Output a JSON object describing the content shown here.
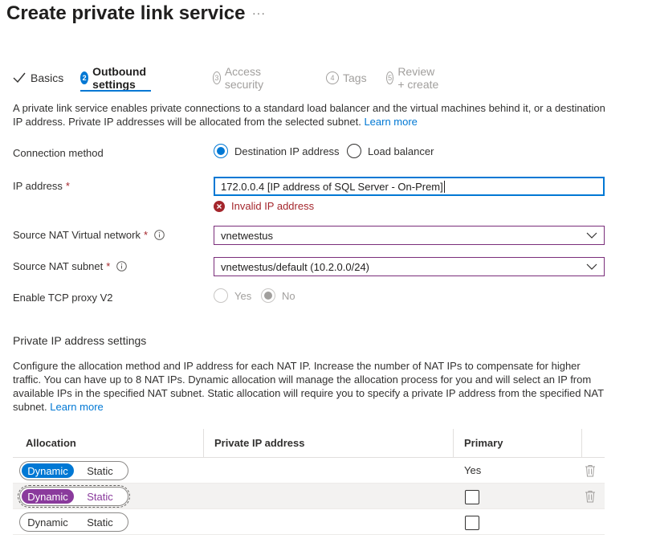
{
  "header": {
    "title": "Create private link service",
    "more": "···"
  },
  "tabs": [
    {
      "label": "Basics",
      "state": "done"
    },
    {
      "num": "2",
      "label": "Outbound settings",
      "state": "active"
    },
    {
      "num": "3",
      "label": "Access security",
      "state": "disabled"
    },
    {
      "num": "4",
      "label": "Tags",
      "state": "disabled"
    },
    {
      "num": "5",
      "label": "Review + create",
      "state": "disabled"
    }
  ],
  "intro": {
    "text": "A private link service enables private connections to a standard load balancer and the virtual machines behind it, or a destination IP address. Private IP addresses will be allocated from the selected subnet.",
    "link": "Learn more"
  },
  "form": {
    "connection_method": {
      "label": "Connection method",
      "options": [
        "Destination IP address",
        "Load balancer"
      ],
      "selected": "Destination IP address"
    },
    "ip_address": {
      "label": "IP address",
      "required": "*",
      "value": "172.0.0.4 [IP address of SQL Server - On-Prem]",
      "error": "Invalid IP address"
    },
    "source_nat_vnet": {
      "label": "Source NAT Virtual network",
      "required": "*",
      "value": "vnetwestus"
    },
    "source_nat_subnet": {
      "label": "Source NAT subnet",
      "required": "*",
      "value": "vnetwestus/default (10.2.0.0/24)"
    },
    "tcp_proxy": {
      "label": "Enable TCP proxy V2",
      "options": [
        "Yes",
        "No"
      ],
      "selected": "No"
    }
  },
  "private_ip": {
    "title": "Private IP address settings",
    "desc": "Configure the allocation method and IP address for each NAT IP. Increase the number of NAT IPs to compensate for higher traffic. You can have up to 8 NAT IPs. Dynamic allocation will manage the allocation process for you and will select an IP from available IPs in the specified NAT subnet. Static allocation will require you to specify a private IP address from the specified NAT subnet.",
    "link": "Learn more",
    "columns": [
      "Allocation",
      "Private IP address",
      "Primary"
    ],
    "toggle_labels": [
      "Dynamic",
      "Static"
    ],
    "rows": [
      {
        "allocation": "Dynamic",
        "primary": "Yes"
      },
      {
        "allocation": "Dynamic",
        "primary": ""
      },
      {
        "allocation": "",
        "primary": ""
      }
    ]
  },
  "colors": {
    "accent": "#0078d4",
    "error": "#a4262c",
    "purple": "#8a3a9c"
  }
}
